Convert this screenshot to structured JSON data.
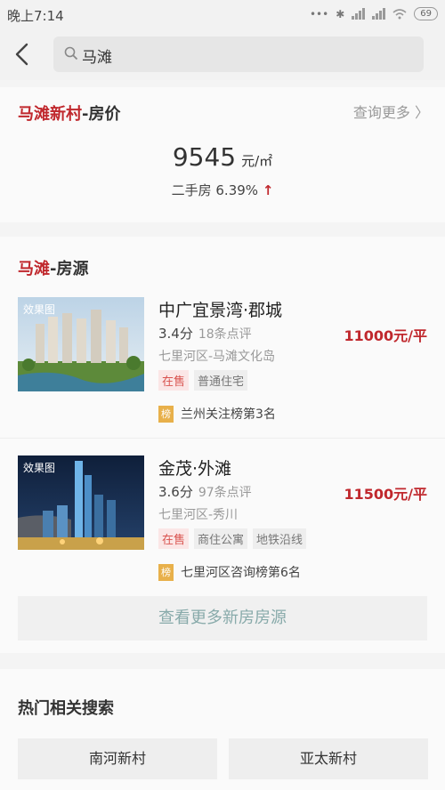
{
  "status_bar": {
    "time": "晚上7:14",
    "battery": "69"
  },
  "search": {
    "query": "马滩"
  },
  "price_section": {
    "title_highlight": "马滩新村",
    "title_suffix": "-房价",
    "more_link": "查询更多 〉",
    "price": "9545",
    "unit": "元/㎡",
    "change_text": "二手房 6.39%",
    "change_arrow": "↑"
  },
  "listing_section": {
    "title_highlight": "马滩",
    "title_suffix": "-房源",
    "items": [
      {
        "thumb_label": "效果图",
        "name": "中广宜景湾·郡城",
        "score": "3.4分",
        "reviews": "18条点评",
        "price": "11000元/平",
        "location": "七里河区-马滩文化岛",
        "tags": [
          "在售",
          "普通住宅"
        ],
        "rank_badge": "榜",
        "rank_text": "兰州关注榜第3名"
      },
      {
        "thumb_label": "效果图",
        "name": "金茂·外滩",
        "score": "3.6分",
        "reviews": "97条点评",
        "price": "11500元/平",
        "location": "七里河区-秀川",
        "tags": [
          "在售",
          "商住公寓",
          "地铁沿线"
        ],
        "rank_badge": "榜",
        "rank_text": "七里河区咨询榜第6名"
      }
    ],
    "more_button": "查看更多新房房源"
  },
  "hot_section": {
    "title": "热门相关搜索",
    "items": [
      "南河新村",
      "亚太新村"
    ]
  },
  "colors": {
    "accent_red": "#c0282d",
    "rank_badge": "#e8b04a",
    "background": "#f4f4f4"
  }
}
